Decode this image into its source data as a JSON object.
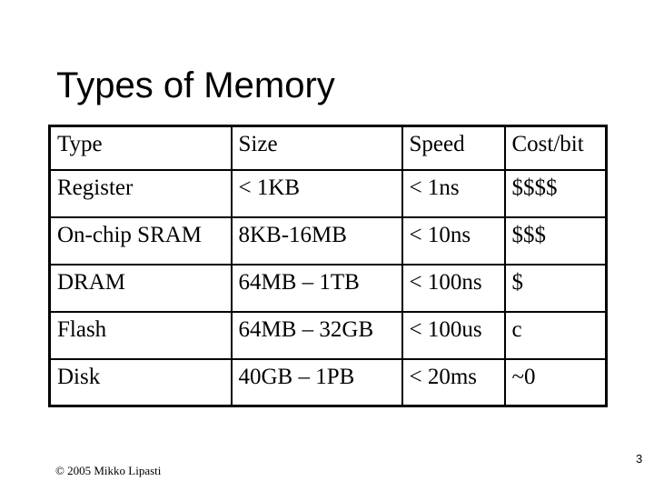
{
  "slide": {
    "title": "Types of Memory",
    "footer": "© 2005 Mikko Lipasti",
    "page_number": "3"
  },
  "table": {
    "headers": [
      "Type",
      "Size",
      "Speed",
      "Cost/bit"
    ],
    "rows": [
      [
        "Register",
        "< 1KB",
        "< 1ns",
        "$$$$"
      ],
      [
        "On-chip SRAM",
        "8KB-16MB",
        "< 10ns",
        "$$$"
      ],
      [
        "DRAM",
        "64MB – 1TB",
        "< 100ns",
        "$"
      ],
      [
        "Flash",
        "64MB – 32GB",
        "< 100us",
        "c"
      ],
      [
        "Disk",
        "40GB – 1PB",
        "< 20ms",
        "~0"
      ]
    ]
  }
}
